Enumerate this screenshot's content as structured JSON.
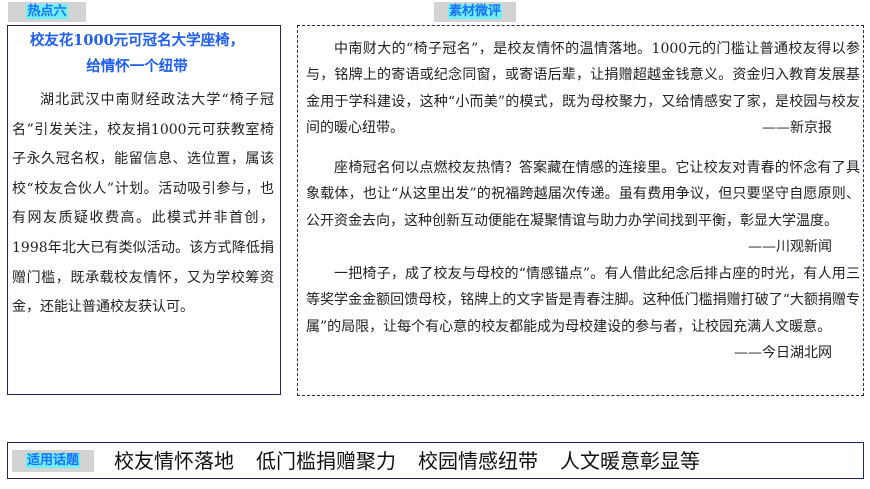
{
  "left_tag": "热点六",
  "right_tag": "素材微评",
  "left": {
    "title_line1": "校友花1000元可冠名大学座椅，",
    "title_line2": "给情怀一个纽带",
    "body": "湖北武汉中南财经政法大学“椅子冠名”引发关注，校友捐1000元可获教室椅子永久冠名权，能留信息、选位置，属该校“校友合伙人”计划。活动吸引参与，也有网友质疑收费高。此模式并非首创，1998年北大已有类似活动。该方式降低捐赠门槛，既承载校友情怀，又为学校筹资金，还能让普通校友获认可。"
  },
  "right": {
    "paragraphs": [
      {
        "text": "中南财大的“椅子冠名”，是校友情怀的温情落地。1000元的门槛让普通校友得以参与，铭牌上的寄语或纪念同窗，或寄语后辈，让捐赠超越金钱意义。资金归入教育发展基金用于学科建设，这种“小而美”的模式，既为母校聚力，又给情感安了家，是校园与校友间的暖心纽带。",
        "source": "——新京报"
      },
      {
        "text": "座椅冠名何以点燃校友热情？答案藏在情感的连接里。它让校友对青春的怀念有了具象载体，也让“从这里出发”的祝福跨越届次传递。虽有费用争议，但只要坚守自愿原则、公开资金去向，这种创新互动便能在凝聚情谊与助力办学间找到平衡，彰显大学温度。",
        "source": "——川观新闻"
      },
      {
        "text": "一把椅子，成了校友与母校的“情感锚点”。有人借此纪念后排占座的时光，有人用三等奖学金金额回馈母校，铭牌上的文字皆是青春注脚。这种低门槛捐赠打破了“大额捐赠专属”的局限，让每个有心意的校友都能成为母校建设的参与者，让校园充满人文暖意。",
        "source": "——今日湖北网"
      }
    ]
  },
  "bottom": {
    "tag": "适用话题",
    "topics": [
      "校友情怀落地",
      "低门槛捐赠聚力",
      "校园情感纽带",
      "人文暖意彰显等"
    ]
  }
}
